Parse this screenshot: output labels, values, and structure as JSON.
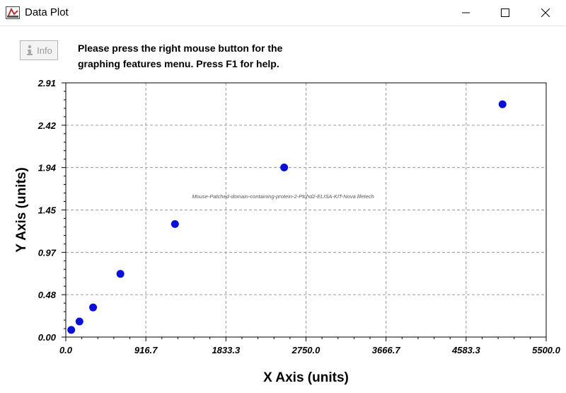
{
  "window": {
    "title": "Data Plot"
  },
  "toolbar": {
    "info_label": "Info",
    "help_line1": "Please press the right mouse button for the",
    "help_line2": "graphing features menu.  Press F1 for help."
  },
  "colors": {
    "points": "#0a10d8",
    "grid": "#9a9a9a",
    "axis": "#000000"
  },
  "chart_data": {
    "type": "scatter",
    "annotation": "Mouse-Patched-domain-containing-protein-2-Ptchd2-ELISA-KIT-Nova lifetech",
    "xlabel": "X Axis (units)",
    "ylabel": "Y Axis (units)",
    "xlim": [
      0,
      5500
    ],
    "ylim": [
      0,
      2.91
    ],
    "x_ticks": [
      "0.0",
      "916.7",
      "1833.3",
      "2750.0",
      "3666.7",
      "4583.3",
      "5500.0"
    ],
    "y_ticks": [
      "0.00",
      "0.48",
      "0.97",
      "1.45",
      "1.94",
      "2.42",
      "2.91"
    ],
    "grid": true,
    "x": [
      62.5,
      156.25,
      312.5,
      625,
      1250,
      2500,
      5000
    ],
    "y": [
      0.082,
      0.178,
      0.339,
      0.723,
      1.294,
      1.941,
      2.665
    ]
  }
}
